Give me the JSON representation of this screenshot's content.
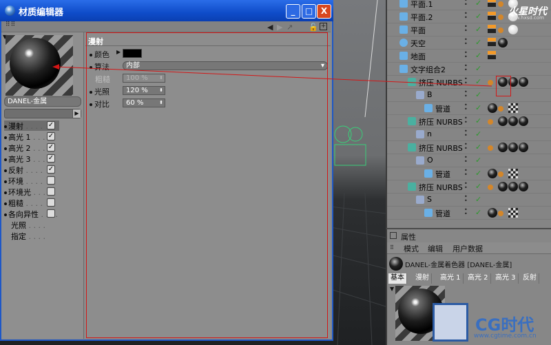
{
  "window": {
    "title": "材质编辑器",
    "min_label": "_",
    "max_label": "□",
    "close_label": "X"
  },
  "left_panel": {
    "material_name": "DANEL-金属",
    "channels": [
      {
        "label": "漫射",
        "checked": true,
        "has_checkbox": true
      },
      {
        "label": "高光 1",
        "checked": true,
        "has_checkbox": true
      },
      {
        "label": "高光 2",
        "checked": true,
        "has_checkbox": true
      },
      {
        "label": "高光 3",
        "checked": true,
        "has_checkbox": true
      },
      {
        "label": "反射",
        "checked": true,
        "has_checkbox": true
      },
      {
        "label": "环境",
        "checked": false,
        "has_checkbox": true
      },
      {
        "label": "环境光",
        "checked": false,
        "has_checkbox": true
      },
      {
        "label": "粗糙",
        "checked": false,
        "has_checkbox": true
      },
      {
        "label": "各向异性",
        "checked": false,
        "has_checkbox": true
      },
      {
        "label": "光照",
        "checked": false,
        "has_checkbox": false
      },
      {
        "label": "指定",
        "checked": false,
        "has_checkbox": false
      }
    ]
  },
  "diffuse": {
    "section_title": "漫射",
    "color_label": "颜色",
    "algorithm_label": "算法",
    "algorithm_value": "内部",
    "roughness_label": "粗糙",
    "roughness_value": "100 %",
    "illumination_label": "光照",
    "illumination_value": "120 %",
    "contrast_label": "对比",
    "contrast_value": "60 %"
  },
  "object_manager": {
    "watermark": "火星时代",
    "watermark_url": "www.hxsd.com",
    "rows": [
      {
        "name": "平面.1",
        "indent": 0
      },
      {
        "name": "平面.2",
        "indent": 0
      },
      {
        "name": "平面",
        "indent": 0
      },
      {
        "name": "天空",
        "indent": 0
      },
      {
        "name": "地面",
        "indent": 0
      },
      {
        "name": "文字组合2",
        "indent": 0
      },
      {
        "name": "挤压 NURBS",
        "indent": 1
      },
      {
        "name": "B",
        "indent": 2
      },
      {
        "name": "管道",
        "indent": 3
      },
      {
        "name": "挤压 NURBS",
        "indent": 1
      },
      {
        "name": "n",
        "indent": 2
      },
      {
        "name": "挤压 NURBS",
        "indent": 1
      },
      {
        "name": "O",
        "indent": 2
      },
      {
        "name": "管道",
        "indent": 3
      },
      {
        "name": "挤压 NURBS",
        "indent": 1
      },
      {
        "name": "S",
        "indent": 2
      },
      {
        "name": "管道",
        "indent": 3
      }
    ]
  },
  "attributes": {
    "title": "属性",
    "menu": [
      "模式",
      "编辑",
      "用户数据"
    ],
    "object_name": "DANEL-金属着色器 [DANEL-金属]",
    "tabs": [
      "基本",
      "漫射",
      "高光 1",
      "高光 2",
      "高光 3",
      "反射"
    ]
  },
  "branding": {
    "logo_text": "CG时代",
    "logo_url": "www.cgtime.com.cn"
  }
}
